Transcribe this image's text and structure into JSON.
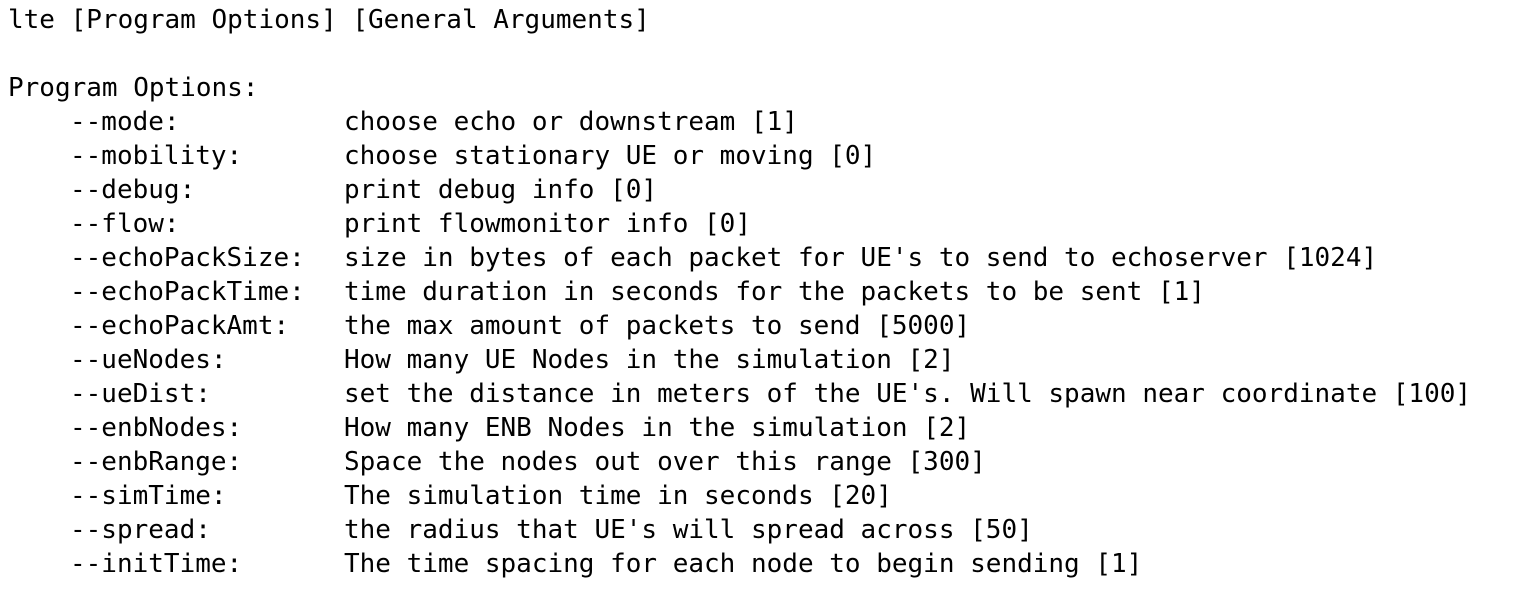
{
  "usage_line": "lte [Program Options] [General Arguments]",
  "section_heading": "Program Options:",
  "options": [
    {
      "flag": "--mode:",
      "desc": "choose echo or downstream [1]"
    },
    {
      "flag": "--mobility:",
      "desc": "choose stationary UE or moving [0]"
    },
    {
      "flag": "--debug:",
      "desc": "print debug info [0]"
    },
    {
      "flag": "--flow:",
      "desc": "print flowmonitor info [0]"
    },
    {
      "flag": "--echoPackSize:",
      "desc": "size in bytes of each packet for UE's to send to echoserver [1024]"
    },
    {
      "flag": "--echoPackTime:",
      "desc": "time duration in seconds for the packets to be sent [1]"
    },
    {
      "flag": "--echoPackAmt:",
      "desc": "the max amount of packets to send [5000]"
    },
    {
      "flag": "--ueNodes:",
      "desc": "How many UE Nodes in the simulation [2]"
    },
    {
      "flag": "--ueDist:",
      "desc": "set the distance in meters of the UE's. Will spawn near coordinate [100]"
    },
    {
      "flag": "--enbNodes:",
      "desc": "How many ENB Nodes in the simulation [2]"
    },
    {
      "flag": "--enbRange:",
      "desc": "Space the nodes out over this range [300]"
    },
    {
      "flag": "--simTime:",
      "desc": "The simulation time in seconds [20]"
    },
    {
      "flag": "--spread:",
      "desc": "the radius that UE's will spread across [50]"
    },
    {
      "flag": "--initTime:",
      "desc": "The time spacing for each node to begin sending [1]"
    }
  ]
}
